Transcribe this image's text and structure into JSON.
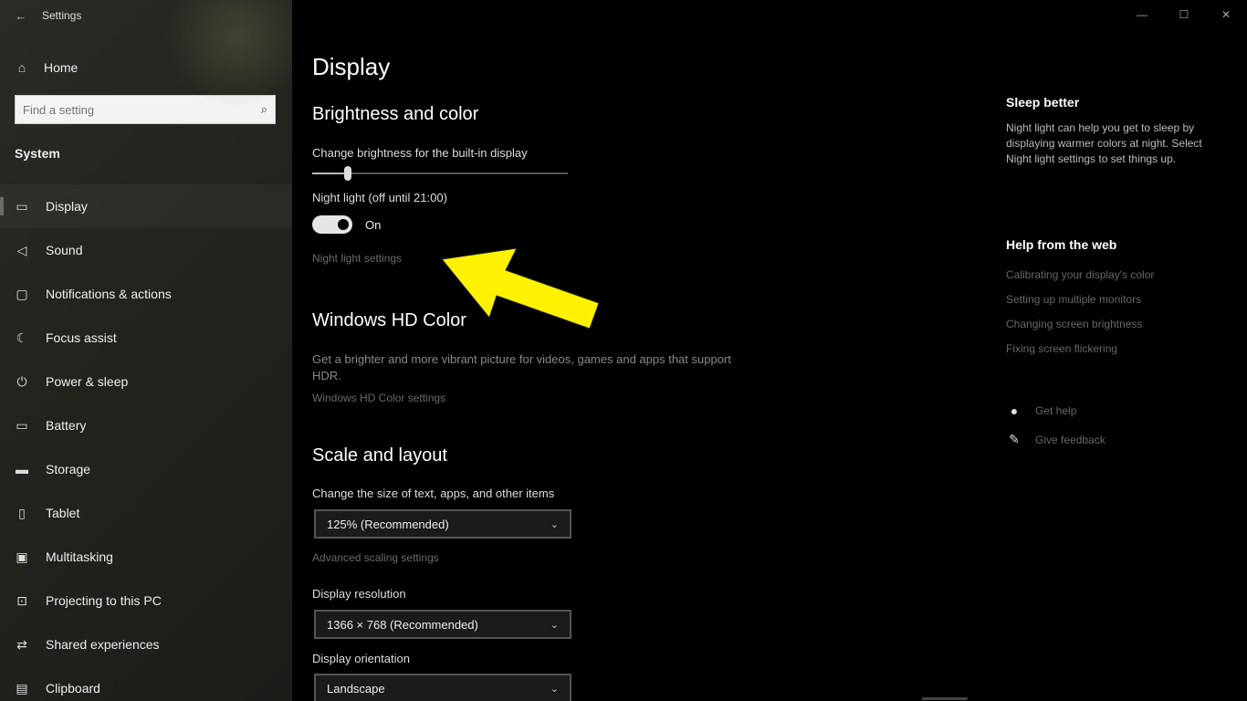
{
  "window": {
    "app_title": "Settings",
    "back_icon": "back-arrow-icon",
    "controls": {
      "minimize": "—",
      "maximize": "☐",
      "close": "✕"
    }
  },
  "sidebar": {
    "home": {
      "label": "Home",
      "icon": "home-icon"
    },
    "search": {
      "placeholder": "Find a setting"
    },
    "section": "System",
    "items": [
      {
        "label": "Display",
        "icon": "monitor-icon",
        "selected": true
      },
      {
        "label": "Sound",
        "icon": "speaker-icon"
      },
      {
        "label": "Notifications & actions",
        "icon": "notification-icon"
      },
      {
        "label": "Focus assist",
        "icon": "moon-icon"
      },
      {
        "label": "Power & sleep",
        "icon": "power-icon"
      },
      {
        "label": "Battery",
        "icon": "battery-icon"
      },
      {
        "label": "Storage",
        "icon": "storage-icon"
      },
      {
        "label": "Tablet",
        "icon": "tablet-icon"
      },
      {
        "label": "Multitasking",
        "icon": "multitasking-icon"
      },
      {
        "label": "Projecting to this PC",
        "icon": "projecting-icon"
      },
      {
        "label": "Shared experiences",
        "icon": "shared-icon"
      },
      {
        "label": "Clipboard",
        "icon": "clipboard-icon"
      }
    ]
  },
  "main": {
    "title": "Display",
    "brightness": {
      "heading": "Brightness and color",
      "slider_label": "Change brightness for the built-in display",
      "brightness_level": 0.14,
      "night_light_label": "Night light (off until 21:00)",
      "toggle_state": "On",
      "night_light_settings_link": "Night light settings"
    },
    "hdr": {
      "heading": "Windows HD Color",
      "description": "Get a brighter and more vibrant picture for videos, games and apps that support HDR.",
      "link": "Windows HD Color settings"
    },
    "scale": {
      "heading": "Scale and layout",
      "size_label": "Change the size of text, apps, and other items",
      "size_value": "125% (Recommended)",
      "advanced_link": "Advanced scaling settings",
      "resolution_label": "Display resolution",
      "resolution_value": "1366 × 768 (Recommended)",
      "orientation_label": "Display orientation",
      "orientation_value": "Landscape"
    }
  },
  "right_panel": {
    "sleep": {
      "heading": "Sleep better",
      "text": "Night light can help you get to sleep by displaying warmer colors at night. Select Night light settings to set things up."
    },
    "help": {
      "heading": "Help from the web",
      "links": [
        "Calibrating your display's color",
        "Setting up multiple monitors",
        "Changing screen brightness",
        "Fixing screen flickering"
      ]
    },
    "actions": [
      {
        "label": "Get help",
        "icon": "help-chat-icon"
      },
      {
        "label": "Give feedback",
        "icon": "feedback-icon"
      }
    ]
  },
  "colors": {
    "annotation_arrow": "#fff200",
    "toggle_on": "#e6e6e6"
  }
}
